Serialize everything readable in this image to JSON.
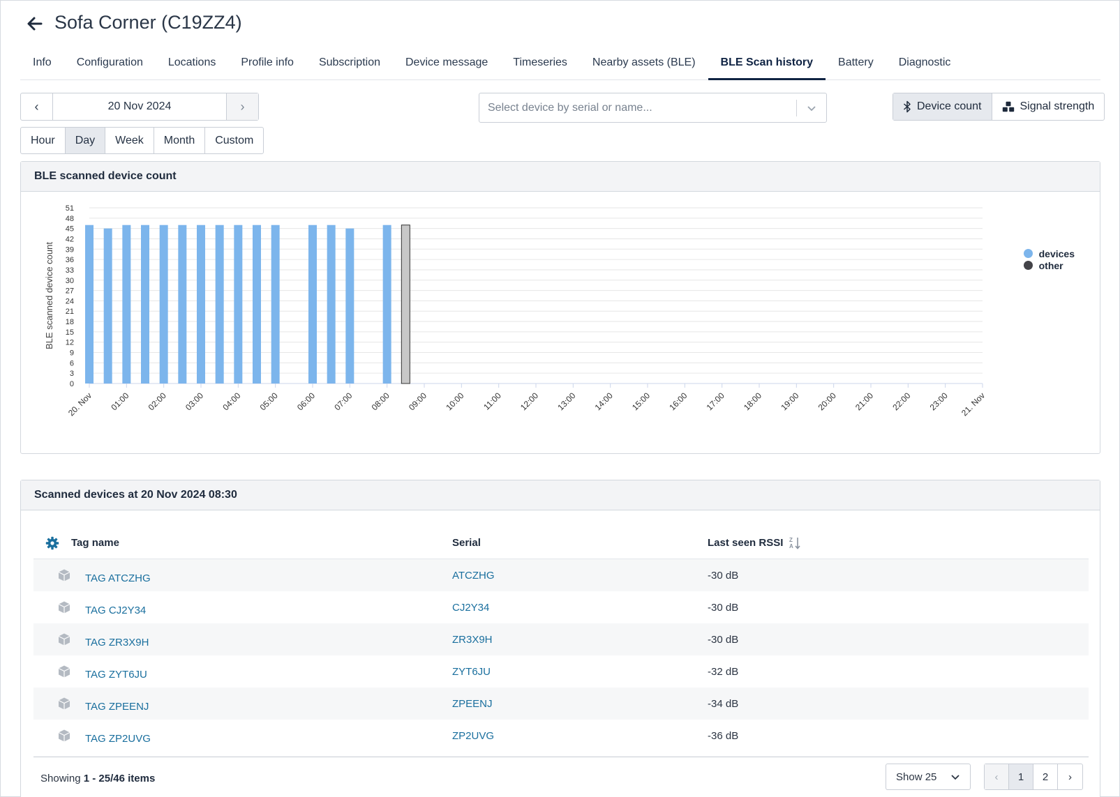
{
  "header": {
    "title": "Sofa Corner (C19ZZ4)",
    "back_icon": "arrow-left-icon"
  },
  "tabs": [
    {
      "label": "Info",
      "active": false
    },
    {
      "label": "Configuration",
      "active": false
    },
    {
      "label": "Locations",
      "active": false
    },
    {
      "label": "Profile info",
      "active": false
    },
    {
      "label": "Subscription",
      "active": false
    },
    {
      "label": "Device message",
      "active": false
    },
    {
      "label": "Timeseries",
      "active": false
    },
    {
      "label": "Nearby assets (BLE)",
      "active": false
    },
    {
      "label": "BLE Scan history",
      "active": true
    },
    {
      "label": "Battery",
      "active": false
    },
    {
      "label": "Diagnostic",
      "active": false
    }
  ],
  "date_nav": {
    "prev": "‹",
    "date": "20 Nov 2024",
    "next": "›"
  },
  "periods": {
    "hour": "Hour",
    "day": "Day",
    "week": "Week",
    "month": "Month",
    "custom": "Custom",
    "selected": "Day"
  },
  "device_select": {
    "placeholder": "Select device by serial or name..."
  },
  "mode_toggle": {
    "device_count": "Device count",
    "signal_strength": "Signal strength",
    "selected": "Device count"
  },
  "chart_panel": {
    "title": "BLE scanned device count"
  },
  "legend": {
    "devices": "devices",
    "other": "other"
  },
  "colors": {
    "devices": "#7cb5ec",
    "other": "#434348",
    "selected_bar": "#c8c8c8",
    "accent": "#0f2343",
    "link": "#1a6f9e"
  },
  "chart_data": {
    "type": "bar",
    "title": "",
    "ylabel": "BLE scanned device count",
    "xlabel": "",
    "ylim": [
      0,
      51
    ],
    "y_ticks": [
      0,
      3,
      6,
      9,
      12,
      15,
      18,
      21,
      24,
      27,
      30,
      33,
      36,
      39,
      42,
      45,
      48,
      51
    ],
    "x_ticks": [
      "20. Nov",
      "01:00",
      "02:00",
      "03:00",
      "04:00",
      "05:00",
      "06:00",
      "07:00",
      "08:00",
      "09:00",
      "10:00",
      "11:00",
      "12:00",
      "13:00",
      "14:00",
      "15:00",
      "16:00",
      "17:00",
      "18:00",
      "19:00",
      "20:00",
      "21:00",
      "22:00",
      "23:00",
      "21. Nov"
    ],
    "x_range_hours": [
      0,
      24
    ],
    "series": [
      {
        "name": "devices",
        "color": "#7cb5ec",
        "points": [
          {
            "t": "00:00",
            "hour": 0.0,
            "value": 46
          },
          {
            "t": "00:30",
            "hour": 0.5,
            "value": 45
          },
          {
            "t": "01:00",
            "hour": 1.0,
            "value": 46
          },
          {
            "t": "01:30",
            "hour": 1.5,
            "value": 46
          },
          {
            "t": "02:00",
            "hour": 2.0,
            "value": 46
          },
          {
            "t": "02:30",
            "hour": 2.5,
            "value": 46
          },
          {
            "t": "03:00",
            "hour": 3.0,
            "value": 46
          },
          {
            "t": "03:30",
            "hour": 3.5,
            "value": 46
          },
          {
            "t": "04:00",
            "hour": 4.0,
            "value": 46
          },
          {
            "t": "04:30",
            "hour": 4.5,
            "value": 46
          },
          {
            "t": "05:00",
            "hour": 5.0,
            "value": 46
          },
          {
            "t": "06:00",
            "hour": 6.0,
            "value": 46
          },
          {
            "t": "06:30",
            "hour": 6.5,
            "value": 46
          },
          {
            "t": "07:00",
            "hour": 7.0,
            "value": 45
          },
          {
            "t": "08:00",
            "hour": 8.0,
            "value": 46
          },
          {
            "t": "08:30",
            "hour": 8.5,
            "value": 46,
            "selected": true
          }
        ]
      },
      {
        "name": "other",
        "color": "#434348",
        "points": []
      }
    ],
    "grid": true,
    "legend_position": "top-right"
  },
  "table_panel": {
    "title": "Scanned devices at 20 Nov 2024 08:30"
  },
  "table": {
    "columns": {
      "tag_name": "Tag name",
      "serial": "Serial",
      "rssi": "Last seen RSSI"
    },
    "settings_icon": "gear-icon",
    "sort_icon": "sort-desc-icon",
    "rows": [
      {
        "icon": "cube-icon",
        "tag": "TAG ATCZHG",
        "serial": "ATCZHG",
        "rssi": "-30 dB"
      },
      {
        "icon": "cube-icon",
        "tag": "TAG CJ2Y34",
        "serial": "CJ2Y34",
        "rssi": "-30 dB"
      },
      {
        "icon": "cube-icon",
        "tag": "TAG ZR3X9H",
        "serial": "ZR3X9H",
        "rssi": "-30 dB"
      },
      {
        "icon": "cube-icon",
        "tag": "TAG ZYT6JU",
        "serial": "ZYT6JU",
        "rssi": "-32 dB"
      },
      {
        "icon": "cube-icon",
        "tag": "TAG ZPEENJ",
        "serial": "ZPEENJ",
        "rssi": "-34 dB"
      },
      {
        "icon": "cube-icon",
        "tag": "TAG ZP2UVG",
        "serial": "ZP2UVG",
        "rssi": "-36 dB"
      }
    ]
  },
  "footer": {
    "showing_prefix": "Showing ",
    "showing_range": "1 - 25/46 items",
    "page_size": "Show 25",
    "pages": {
      "prev": "‹",
      "p1": "1",
      "p2": "2",
      "next": "›"
    },
    "current_page": 1
  }
}
